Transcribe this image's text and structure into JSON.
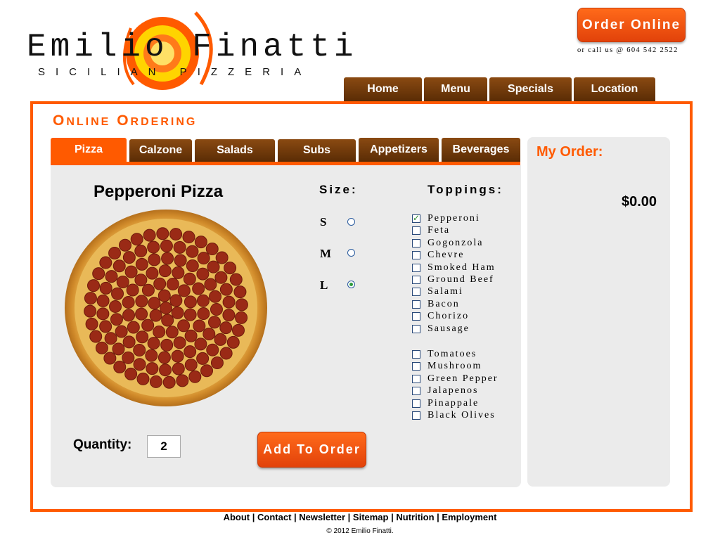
{
  "logo": {
    "name": "Emilio Finatti",
    "subtitle": "SICILIAN PIZZERIA"
  },
  "header": {
    "order_online_label": "Order Online",
    "call_us": "or call us @ 604 542 2522",
    "nav": [
      "Home",
      "Menu",
      "Specials",
      "Location"
    ]
  },
  "section": {
    "title_first": "O",
    "title_first_rest": "NLINE",
    "title_second": "O",
    "title_second_rest": "RDERING"
  },
  "categories": [
    "Pizza",
    "Calzone",
    "Salads",
    "Subs",
    "Appetizers",
    "Beverages"
  ],
  "active_category": "Pizza",
  "product": {
    "title": "Pepperoni Pizza",
    "size_label": "Size:",
    "sizes": [
      {
        "label": "S",
        "selected": false
      },
      {
        "label": "M",
        "selected": false
      },
      {
        "label": "L",
        "selected": true
      }
    ],
    "toppings_label": "Toppings:",
    "toppings_group1": [
      {
        "label": "Pepperoni",
        "checked": true
      },
      {
        "label": "Feta",
        "checked": false
      },
      {
        "label": "Gogonzola",
        "checked": false
      },
      {
        "label": "Chevre",
        "checked": false
      },
      {
        "label": "Smoked Ham",
        "checked": false
      },
      {
        "label": "Ground Beef",
        "checked": false
      },
      {
        "label": "Salami",
        "checked": false
      },
      {
        "label": "Bacon",
        "checked": false
      },
      {
        "label": "Chorizo",
        "checked": false
      },
      {
        "label": "Sausage",
        "checked": false
      }
    ],
    "toppings_group2": [
      {
        "label": "Tomatoes",
        "checked": false
      },
      {
        "label": "Mushroom",
        "checked": false
      },
      {
        "label": "Green Pepper",
        "checked": false
      },
      {
        "label": "Jalapenos",
        "checked": false
      },
      {
        "label": "Pinappale",
        "checked": false
      },
      {
        "label": "Black Olives",
        "checked": false
      }
    ],
    "quantity_label": "Quantity:",
    "quantity": "2",
    "add_label": "Add To Order"
  },
  "order": {
    "title": "My Order:",
    "total": "$0.00"
  },
  "footer": {
    "links": [
      "About",
      "Contact",
      "Newsletter",
      "Sitemap",
      "Nutrition",
      "Employment"
    ],
    "copyright": "© 2012 Emilio Finatti."
  },
  "colors": {
    "accent": "#ff5a00",
    "tab_brown": "#6b3508",
    "panel_gray": "#ebebeb"
  }
}
